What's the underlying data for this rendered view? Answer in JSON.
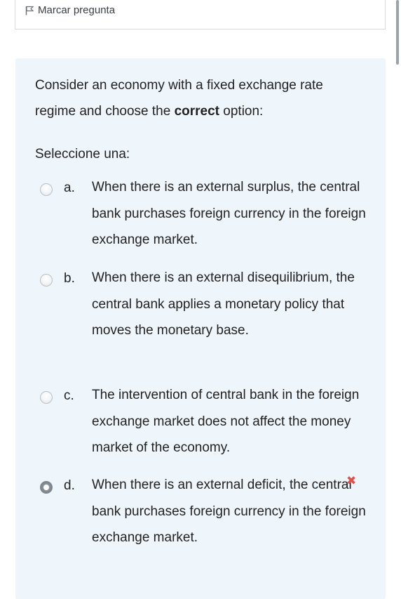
{
  "flag": {
    "label": "Marcar pregunta",
    "icon": "flag-icon"
  },
  "question": {
    "text_before": "Consider an economy with a fixed exchange rate regime and choose the ",
    "text_bold": "correct",
    "text_after": " option:",
    "prompt": "Seleccione una:"
  },
  "options": [
    {
      "letter": "a.",
      "text": "When there is an external surplus, the central bank purchases foreign currency in the foreign exchange market.",
      "selected": false
    },
    {
      "letter": "b.",
      "text": "When there is an external disequilibrium, the central bank applies a monetary policy that moves the monetary base.",
      "selected": false
    },
    {
      "letter": "c.",
      "text": "The intervention of central bank in the foreign exchange market does not affect the money market of the economy.",
      "selected": false
    },
    {
      "letter": "d.",
      "text": "When there is an external deficit, the central bank purchases foreign currency in the foreign exchange market.",
      "selected": true
    }
  ],
  "feedback": {
    "incorrect_icon": "cross-icon",
    "incorrect_symbol": "✖",
    "color": "#d9534f"
  },
  "colors": {
    "card_bg": "#eef5fb",
    "text": "#222222"
  }
}
